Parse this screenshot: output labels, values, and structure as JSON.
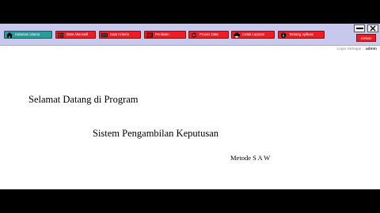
{
  "nav": [
    {
      "label": "Halaman Utama",
      "icon": "home-icon"
    },
    {
      "label": "Data Alternatif",
      "icon": "list-icon"
    },
    {
      "label": "Data Kriteria",
      "icon": "criteria-icon"
    },
    {
      "label": "Penilaian",
      "icon": "rating-icon"
    },
    {
      "label": "Proses Data",
      "icon": "refresh-icon"
    },
    {
      "label": "Cetak Laporan",
      "icon": "printer-icon"
    },
    {
      "label": "Tentang Aplikasi",
      "icon": "info-icon"
    }
  ],
  "window": {
    "exit_label": "Keluar"
  },
  "login": {
    "label": "Login Sebagai :",
    "user": "admin"
  },
  "welcome": {
    "line1": "Selamat Datang di Program",
    "line2": "Sistem Pengambilan Keputusan",
    "line3": "Metode S A W"
  },
  "colors": {
    "nav_button": "#ee1c24",
    "nav_active": "#2a9a9a",
    "toolbar": "#c8c8ec"
  }
}
